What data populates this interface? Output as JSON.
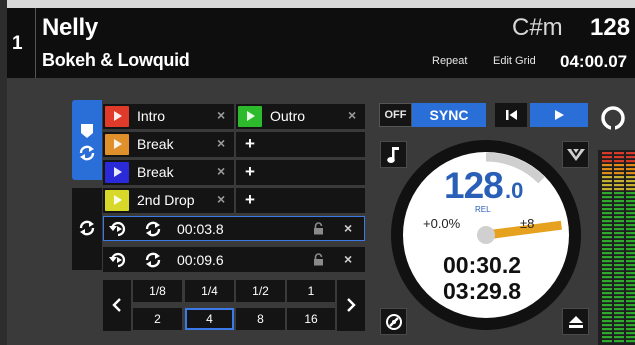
{
  "deck": {
    "number": "1",
    "title": "Nelly",
    "artist": "Bokeh & Lowquid",
    "key": "C#m",
    "bpm_header": "128",
    "repeat_label": "Repeat",
    "edit_grid_label": "Edit Grid",
    "remaining_time_header": "04:00.07"
  },
  "hotcues": [
    {
      "label": "Intro",
      "color": "#e03a2a",
      "close": "×"
    },
    {
      "label": "Outro",
      "color": "#2dbb2d",
      "close": "×"
    },
    {
      "label": "Break",
      "color": "#e0902a",
      "close": "×"
    },
    {
      "label": "Break",
      "color": "#2a2ad8",
      "close": "×"
    },
    {
      "label": "2nd Drop",
      "color": "#d8d82a",
      "close": "×"
    }
  ],
  "empty_cue_symbol": "+",
  "loops": [
    {
      "time": "00:03.8",
      "close": "×"
    },
    {
      "time": "00:09.6",
      "close": "×"
    }
  ],
  "loop_sizes_top": [
    "1/8",
    "1/4",
    "1/2",
    "1"
  ],
  "loop_sizes_bottom": [
    "2",
    "4",
    "8",
    "16"
  ],
  "selected_loop_size": "4",
  "transport": {
    "off_label": "OFF",
    "sync_label": "SYNC"
  },
  "platter": {
    "bpm_int": "128",
    "bpm_dec": ".0",
    "rel_label": "REL",
    "pitch": "+0.0%",
    "range": "±8",
    "elapsed": "00:30.2",
    "remaining": "03:29.8",
    "progress_fraction": 0.126
  },
  "colors": {
    "accent_blue": "#2a6ed8",
    "platter_number_blue": "#2a5fb8",
    "needle_orange": "#e6a21e",
    "meter_green": "#2faa2f",
    "meter_orange": "#e08a1a",
    "meter_red": "#d83a2a"
  },
  "icons": [
    "cue-marker-icon",
    "loop-icon",
    "beat-jump-icon",
    "music-note-icon",
    "prev-track-icon",
    "play-icon",
    "slip-icon",
    "key-lock-icon",
    "eject-icon",
    "lock-icon",
    "chevron-left-icon",
    "chevron-right-icon"
  ]
}
